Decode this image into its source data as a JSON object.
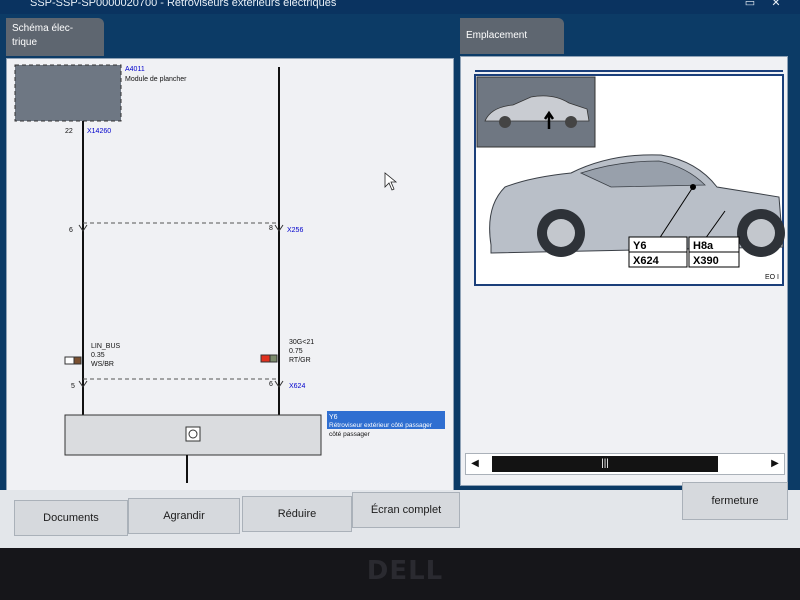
{
  "window": {
    "title": "SSP-SSP-SP0000020700 - Rétroviseurs extérieurs électriques"
  },
  "tabs": {
    "left": "Schéma élec-trique",
    "right": "Emplacement"
  },
  "schematic": {
    "module_id": "A4011",
    "module_name": "Module de plancher",
    "pin_22": "22",
    "conn_x14260": "X14260",
    "pin_6_top": "6",
    "pin_8_top": "8",
    "conn_x256": "X256",
    "wire1_name": "LIN_BUS",
    "wire1_gauge": "0.35",
    "wire1_color": "WS/BR",
    "wire2_name": "30G<21",
    "wire2_gauge": "0.75",
    "wire2_color": "RT/GR",
    "pin_5": "5",
    "pin_6_bottom": "6",
    "conn_x624": "X624",
    "component_id": "Y6",
    "component_name": "Rétroviseur extérieur côté passager",
    "component_name2": "côté passager"
  },
  "location": {
    "callout_y6": "Y6",
    "callout_x624": "X624",
    "callout_h8a": "H8a",
    "callout_x390": "X390",
    "corner_code": "EO I"
  },
  "buttons": {
    "documents": "Documents",
    "agrandir": "Agrandir",
    "reduire": "Réduire",
    "ecran_complet": "Écran complet",
    "fermeture": "fermeture"
  },
  "bezel": {
    "logo": "DELL"
  },
  "colors": {
    "accent_blue": "#0000cc",
    "highlight": "#2f6fd1",
    "wire_red": "#e0301e"
  }
}
